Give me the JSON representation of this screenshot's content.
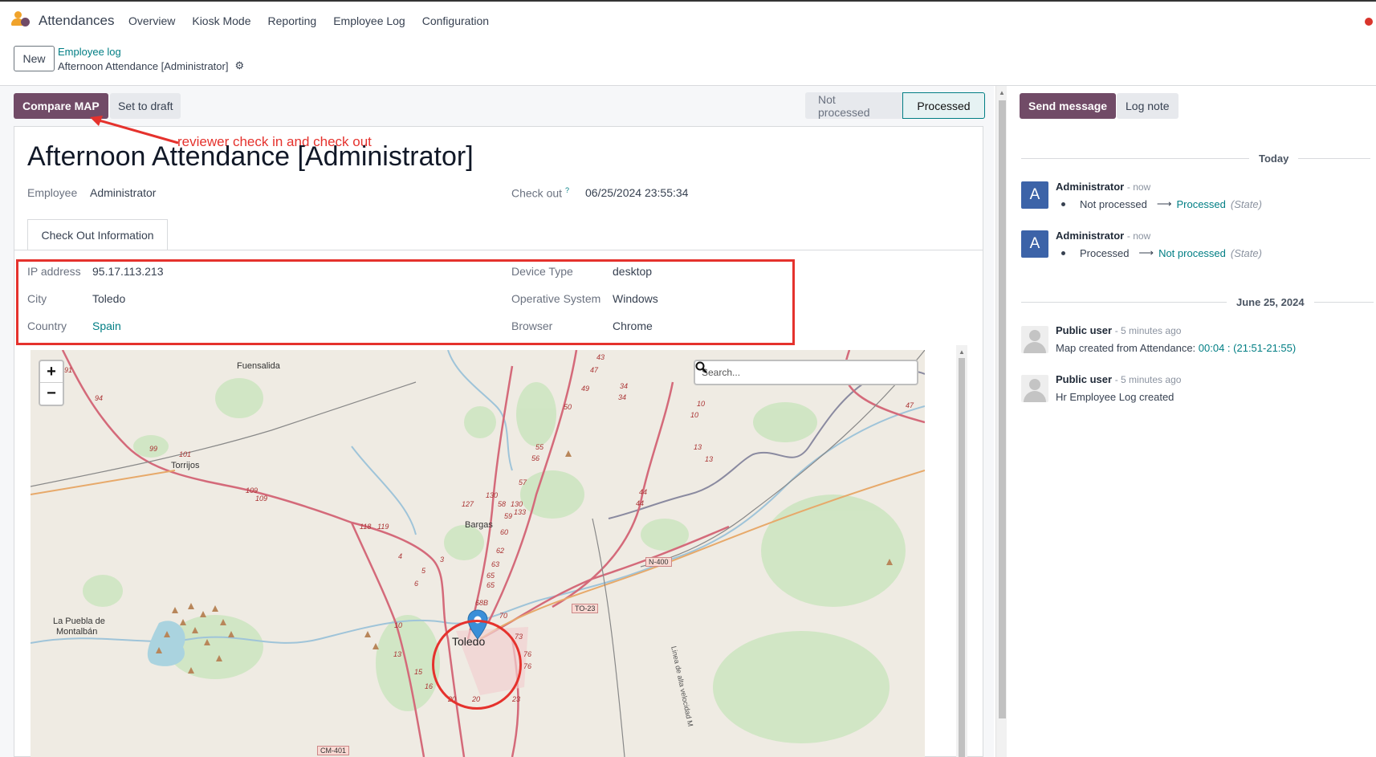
{
  "app": {
    "title": "Attendances",
    "menu": [
      "Overview",
      "Kiosk Mode",
      "Reporting",
      "Employee Log",
      "Configuration"
    ]
  },
  "control_panel": {
    "new_label": "New",
    "breadcrumb_parent": "Employee log",
    "breadcrumb_current": "Afternoon Attendance [Administrator]"
  },
  "header": {
    "compare_map_label": "Compare MAP",
    "set_to_draft_label": "Set to draft",
    "stages": [
      "Not processed",
      "Processed"
    ],
    "active_stage": "Processed"
  },
  "annotation": {
    "text": "reviewer check in and check out"
  },
  "form": {
    "title": "Afternoon Attendance [Administrator]",
    "employee_label": "Employee",
    "employee_value": "Administrator",
    "checkout_label": "Check out",
    "checkout_help": "?",
    "checkout_value": "06/25/2024 23:55:34",
    "tab_label": "Check Out Information",
    "ip_label": "IP address",
    "ip_value": "95.17.113.213",
    "city_label": "City",
    "city_value": "Toledo",
    "country_label": "Country",
    "country_value": "Spain",
    "device_label": "Device Type",
    "device_value": "desktop",
    "os_label": "Operative System",
    "os_value": "Windows",
    "browser_label": "Browser",
    "browser_value": "Chrome"
  },
  "map": {
    "zoom_in": "+",
    "zoom_out": "−",
    "search_placeholder": "Search...",
    "places": [
      "Fuensalida",
      "Torrijos",
      "Bargas",
      "La Puebla de",
      "Montalbán",
      "Toledo"
    ],
    "road_tags": [
      "N-400",
      "TO-23",
      "CM-401"
    ],
    "road_numbers": [
      "91",
      "94",
      "99",
      "101",
      "109",
      "109",
      "118",
      "119",
      "4",
      "3",
      "5",
      "6",
      "10",
      "13",
      "15",
      "16",
      "20",
      "20",
      "23",
      "127",
      "130",
      "58",
      "130",
      "59",
      "133",
      "60",
      "62",
      "63",
      "65",
      "65",
      "68B",
      "70",
      "73",
      "76",
      "76",
      "55",
      "56",
      "57",
      "50",
      "47",
      "43",
      "49",
      "34",
      "34",
      "10",
      "10",
      "13",
      "13",
      "44",
      "44",
      "47"
    ],
    "rail_label": "Linea de alta velocidad M"
  },
  "chatter": {
    "send_message_label": "Send message",
    "log_note_label": "Log note",
    "groups": [
      {
        "date": "Today",
        "messages": [
          {
            "avatar": "A",
            "author": "Administrator",
            "time": "- now",
            "old": "Not processed",
            "new": "Processed",
            "field": "(State)"
          },
          {
            "avatar": "A",
            "author": "Administrator",
            "time": "- now",
            "old": "Processed",
            "new": "Not processed",
            "field": "(State)"
          }
        ]
      },
      {
        "date": "June 25, 2024",
        "messages": [
          {
            "author": "Public user",
            "time": "- 5 minutes ago",
            "body_prefix": "Map created from Attendance: ",
            "body_link": "00:04 : (21:51-21:55)"
          },
          {
            "author": "Public user",
            "time": "- 5 minutes ago",
            "body": "Hr Employee Log created"
          }
        ]
      }
    ]
  },
  "colors": {
    "primary": "#714b67",
    "link": "#017e84",
    "annotation": "#e5322d",
    "avatar": "#3c63a8"
  }
}
